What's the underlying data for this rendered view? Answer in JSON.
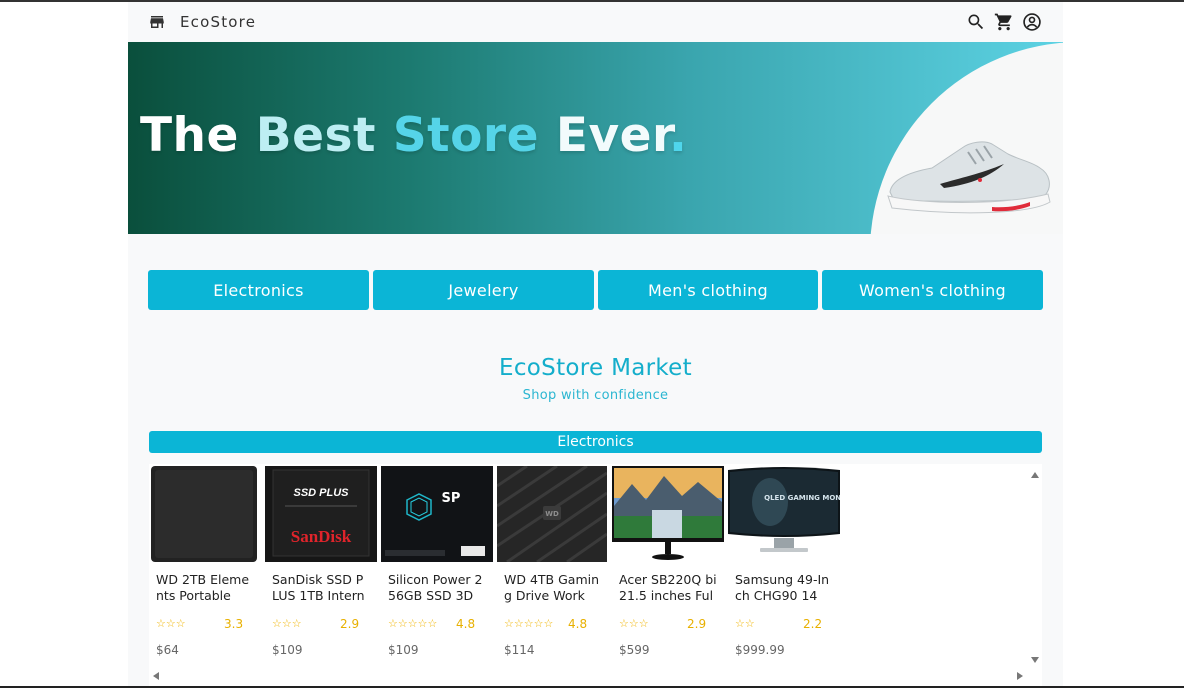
{
  "nav": {
    "brand": "EcoStore",
    "icons": [
      "store-icon",
      "search-icon",
      "cart-icon",
      "account-icon"
    ]
  },
  "hero": {
    "words": [
      "The",
      "Best",
      "Store",
      "Ever",
      "."
    ]
  },
  "categories": [
    "Electronics",
    "Jewelery",
    "Men's clothing",
    "Women's clothing"
  ],
  "market": {
    "title": "EcoStore Market",
    "subtitle": "Shop with confidence"
  },
  "section": {
    "title": "Electronics"
  },
  "products": [
    {
      "name": "WD 2TB Elements Portable E...",
      "stars": "☆☆☆",
      "rating": "3.3",
      "price": "$64"
    },
    {
      "name": "SanDisk SSD PLUS 1TB Interna...",
      "stars": "☆☆☆",
      "rating": "2.9",
      "price": "$109"
    },
    {
      "name": "Silicon Power 256GB SSD 3D ...",
      "stars": "☆☆☆☆☆",
      "rating": "4.8",
      "price": "$109"
    },
    {
      "name": "WD 4TB Gaming Drive Works...",
      "stars": "☆☆☆☆☆",
      "rating": "4.8",
      "price": "$114"
    },
    {
      "name": "Acer SB220Q bi 21.5 inches Full...",
      "stars": "☆☆☆",
      "rating": "2.9",
      "price": "$599"
    },
    {
      "name": "Samsung 49-Inch CHG90 144...",
      "stars": "☆☆",
      "rating": "2.2",
      "price": "$999.99"
    }
  ],
  "product_image_text": {
    "sandisk_top": "SSD PLUS",
    "sandisk_brand": "SanDisk",
    "sp_logo": "SP",
    "wd_logo": "WD",
    "samsung_text": "QLED GAMING MONITOR"
  },
  "colors": {
    "accent": "#0bb5d6",
    "star": "#f0b400",
    "hero_start": "#0a4f3c",
    "hero_end": "#5cd2e3"
  }
}
